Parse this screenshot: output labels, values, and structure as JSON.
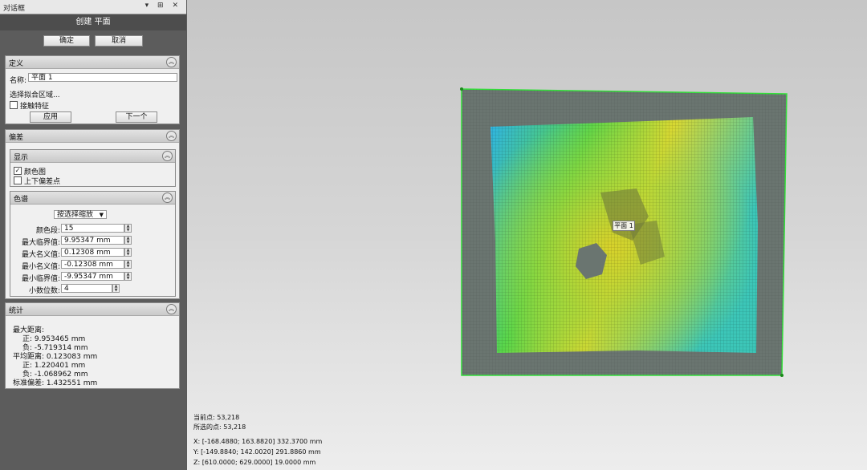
{
  "panel": {
    "window_title": "对话框",
    "titlebar_icons": "▾ ⊞ ✕",
    "operation_title": "创建 平面",
    "ok_label": "确定",
    "cancel_label": "取消"
  },
  "definition": {
    "header": "定义",
    "name_label": "名称:",
    "name_value": "平面 1",
    "select_region_label": "选择拟合区域...",
    "contact_feature_label": "接触特征",
    "contact_feature_checked": false,
    "apply_label": "应用",
    "next_label": "下一个"
  },
  "deviation": {
    "header": "偏差",
    "display": {
      "header": "显示",
      "color_map_label": "颜色图",
      "color_map_checked": true,
      "updown_points_label": "上下偏差点",
      "updown_points_checked": false
    },
    "color_scale": {
      "header": "色谱",
      "mode_value": "按选择缩放",
      "fields": [
        {
          "label": "颜色段:",
          "value": "15"
        },
        {
          "label": "最大临界值:",
          "value": "9.95347 mm"
        },
        {
          "label": "最大名义值:",
          "value": "0.12308 mm"
        },
        {
          "label": "最小名义值:",
          "value": "-0.12308 mm"
        },
        {
          "label": "最小临界值:",
          "value": "-9.95347 mm"
        },
        {
          "label": "小数位数:",
          "value": "4"
        }
      ]
    }
  },
  "statistics": {
    "header": "统计",
    "lines": [
      "最大距离:",
      "正: 9.953465 mm",
      "负: -5.719314 mm",
      "平均距离: 0.123083 mm",
      "正: 1.220401 mm",
      "负: -1.068962 mm",
      "标准偏差: 1.432551 mm"
    ]
  },
  "viewport": {
    "plane_label": "平面 1",
    "current_points": "当前点: 53,218",
    "selected_points": "所选的点: 53,218",
    "x_range": "X:  [-168.4880; 163.8820] 332.3700 mm",
    "y_range": "Y:  [-149.8840; 142.0020] 291.8860 mm",
    "z_range": "Z:  [610.0000; 629.0000] 19.0000 mm"
  },
  "colors": {
    "panel_bg": "#5c5c5c",
    "plane_border": "#33e03a",
    "deviation_low": "#2fb4e6",
    "deviation_mid": "#5ad64a",
    "deviation_high": "#d8d832"
  }
}
